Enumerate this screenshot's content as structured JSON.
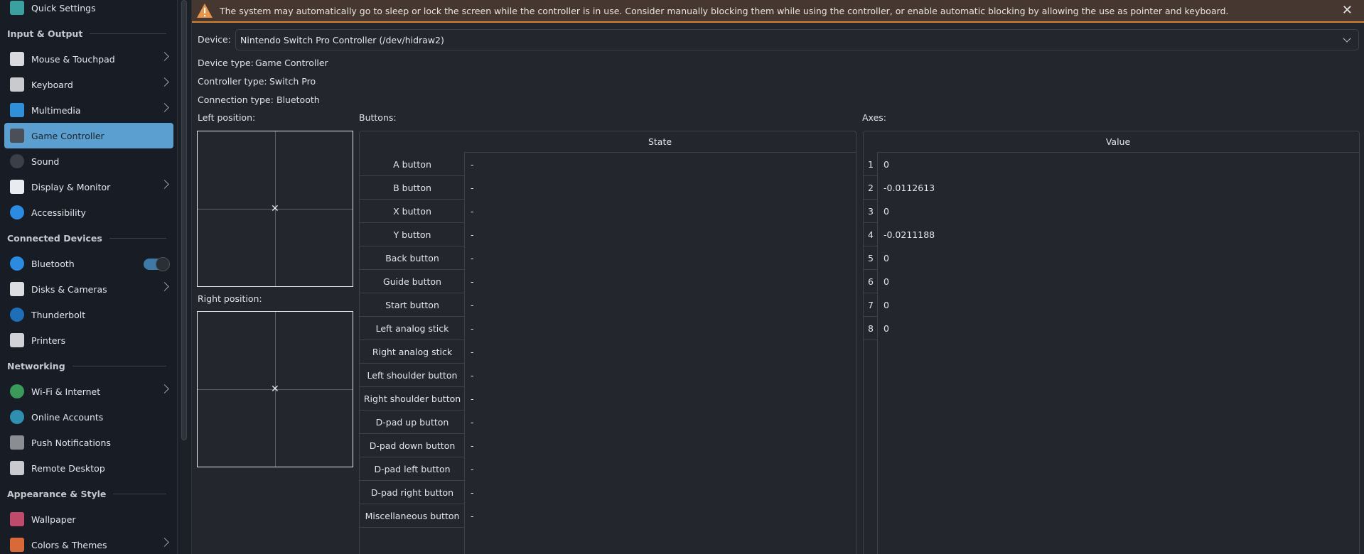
{
  "sidebar": {
    "entries": [
      {
        "type": "item",
        "label": "Quick Settings",
        "icon": "quick-settings-icon",
        "color": "#3aa0a0"
      },
      {
        "type": "header",
        "label": "Input & Output"
      },
      {
        "type": "item",
        "label": "Mouse & Touchpad",
        "icon": "mouse-icon",
        "color": "#d8dade",
        "chevron": true
      },
      {
        "type": "item",
        "label": "Keyboard",
        "icon": "keyboard-icon",
        "color": "#c8cace",
        "chevron": true
      },
      {
        "type": "item",
        "label": "Multimedia",
        "icon": "multimedia-icon",
        "color": "#2f8fd8",
        "chevron": true
      },
      {
        "type": "item",
        "label": "Game Controller",
        "icon": "game-controller-icon",
        "color": "#4a4f58",
        "active": true
      },
      {
        "type": "item",
        "label": "Sound",
        "icon": "sound-icon",
        "color": "#3a3f48",
        "round": true
      },
      {
        "type": "item",
        "label": "Display & Monitor",
        "icon": "display-icon",
        "color": "#e8ecf0",
        "chevron": true
      },
      {
        "type": "item",
        "label": "Accessibility",
        "icon": "accessibility-icon",
        "color": "#2a8be0",
        "round": true
      },
      {
        "type": "header",
        "label": "Connected Devices"
      },
      {
        "type": "item",
        "label": "Bluetooth",
        "icon": "bluetooth-icon",
        "color": "#2a8be0",
        "round": true,
        "toggle": true
      },
      {
        "type": "item",
        "label": "Disks & Cameras",
        "icon": "disk-icon",
        "color": "#dcdde0",
        "chevron": true
      },
      {
        "type": "item",
        "label": "Thunderbolt",
        "icon": "thunderbolt-icon",
        "color": "#1f6fb8",
        "round": true
      },
      {
        "type": "item",
        "label": "Printers",
        "icon": "printer-icon",
        "color": "#d0d2d6"
      },
      {
        "type": "header",
        "label": "Networking"
      },
      {
        "type": "item",
        "label": "Wi-Fi & Internet",
        "icon": "globe-icon",
        "color": "#3a9a5a",
        "round": true,
        "chevron": true
      },
      {
        "type": "item",
        "label": "Online Accounts",
        "icon": "online-accounts-icon",
        "color": "#2f8fb0",
        "round": true
      },
      {
        "type": "item",
        "label": "Push Notifications",
        "icon": "push-notifications-icon",
        "color": "#8a8d92"
      },
      {
        "type": "item",
        "label": "Remote Desktop",
        "icon": "remote-desktop-icon",
        "color": "#c8cace"
      },
      {
        "type": "header",
        "label": "Appearance & Style"
      },
      {
        "type": "item",
        "label": "Wallpaper",
        "icon": "wallpaper-icon",
        "color": "#c04a6a"
      },
      {
        "type": "item",
        "label": "Colors & Themes",
        "icon": "colors-icon",
        "color": "#d86a3a",
        "chevron": true
      }
    ]
  },
  "banner": {
    "text": "The system may automatically go to sleep or lock the screen while the controller is in use. Consider manually blocking them while using the controller, or enable automatic blocking by allowing the use as pointer and keyboard.",
    "close": "✕"
  },
  "device": {
    "label": "Device:",
    "value": "Nintendo Switch Pro Controller (/dev/hidraw2)",
    "type_label": "Device type:",
    "type_value": "Game Controller",
    "controller_label": "Controller type:",
    "controller_value": "Switch Pro",
    "connection_label": "Connection type:",
    "connection_value": "Bluetooth"
  },
  "positions": {
    "left_label": "Left position:",
    "right_label": "Right position:",
    "marker": "✕"
  },
  "buttons": {
    "label": "Buttons:",
    "header": "State",
    "rows": [
      {
        "name": "A button",
        "state": "-"
      },
      {
        "name": "B button",
        "state": "-"
      },
      {
        "name": "X button",
        "state": "-"
      },
      {
        "name": "Y button",
        "state": "-"
      },
      {
        "name": "Back button",
        "state": "-"
      },
      {
        "name": "Guide button",
        "state": "-"
      },
      {
        "name": "Start button",
        "state": "-"
      },
      {
        "name": "Left analog stick",
        "state": "-"
      },
      {
        "name": "Right analog stick",
        "state": "-"
      },
      {
        "name": "Left shoulder button",
        "state": "-"
      },
      {
        "name": "Right shoulder button",
        "state": "-"
      },
      {
        "name": "D-pad up button",
        "state": "-"
      },
      {
        "name": "D-pad down button",
        "state": "-"
      },
      {
        "name": "D-pad left button",
        "state": "-"
      },
      {
        "name": "D-pad right button",
        "state": "-"
      },
      {
        "name": "Miscellaneous button",
        "state": "-"
      }
    ]
  },
  "axes": {
    "label": "Axes:",
    "header": "Value",
    "rows": [
      {
        "n": "1",
        "value": "0"
      },
      {
        "n": "2",
        "value": "-0.0112613"
      },
      {
        "n": "3",
        "value": "0"
      },
      {
        "n": "4",
        "value": "-0.0211188"
      },
      {
        "n": "5",
        "value": "0"
      },
      {
        "n": "6",
        "value": "0"
      },
      {
        "n": "7",
        "value": "0"
      },
      {
        "n": "8",
        "value": "0"
      }
    ]
  }
}
